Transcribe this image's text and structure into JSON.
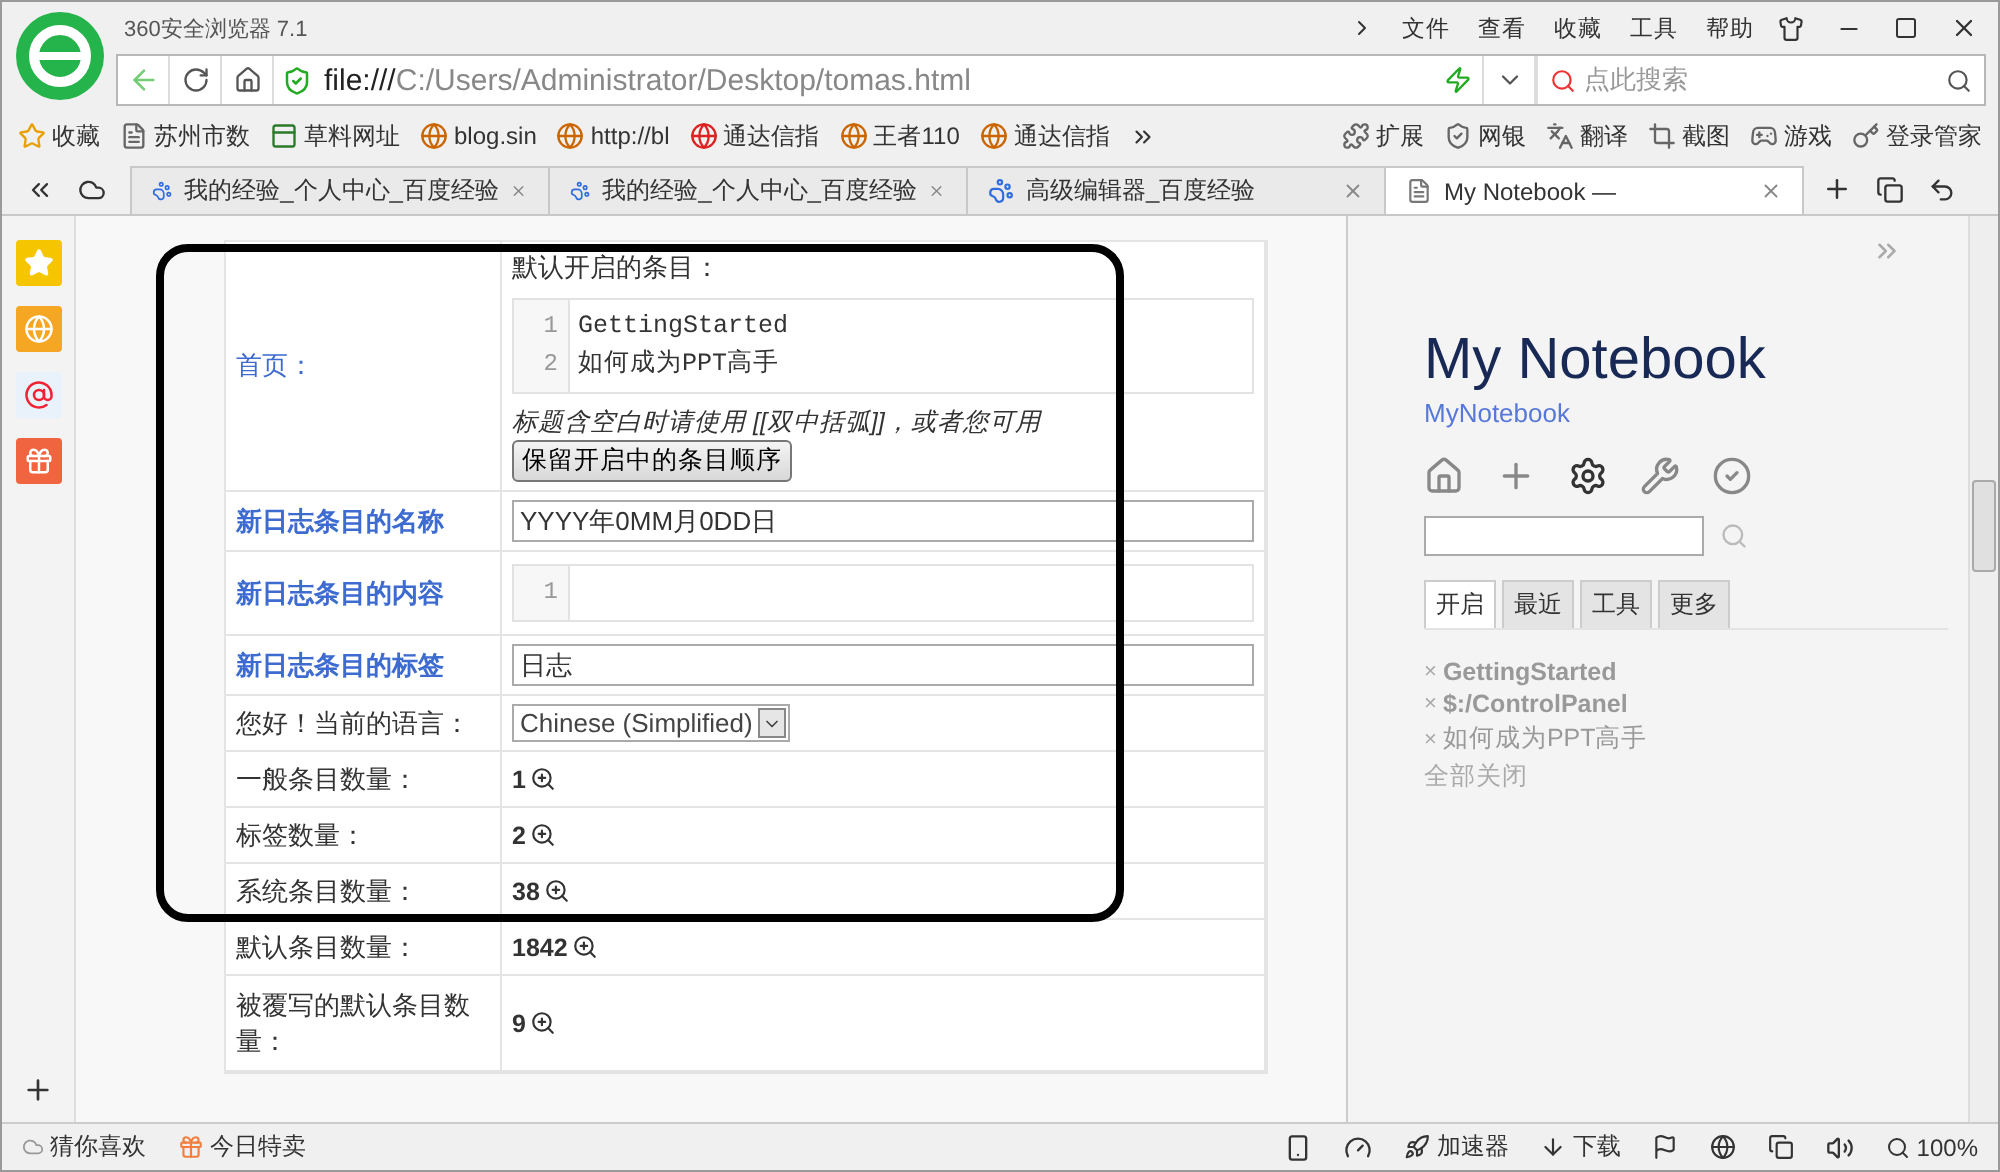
{
  "window": {
    "title": "360安全浏览器 7.1",
    "menu": [
      "文件",
      "查看",
      "收藏",
      "工具",
      "帮助"
    ]
  },
  "address": {
    "scheme": "file:///",
    "path": "C:/Users/Administrator/Desktop/tomas.html",
    "search_placeholder": "点此搜索"
  },
  "bookmarks": [
    {
      "label": "收藏",
      "kind": "star"
    },
    {
      "label": "苏州市数",
      "kind": "page"
    },
    {
      "label": "草料网址",
      "kind": "qr"
    },
    {
      "label": "blog.sin",
      "kind": "site"
    },
    {
      "label": "http://bl",
      "kind": "site"
    },
    {
      "label": "通达信指",
      "kind": "red"
    },
    {
      "label": "王者110",
      "kind": "site"
    },
    {
      "label": "通达信指",
      "kind": "site"
    }
  ],
  "tools": [
    "扩展",
    "网银",
    "翻译",
    "截图",
    "游戏",
    "登录管家"
  ],
  "tabs": [
    {
      "label": "我的经验_个人中心_百度经验",
      "selected": false
    },
    {
      "label": "我的经验_个人中心_百度经验",
      "selected": false
    },
    {
      "label": "高级编辑器_百度经验",
      "selected": false
    },
    {
      "label": "My Notebook —",
      "selected": true
    }
  ],
  "table": {
    "rows": [
      {
        "kind": "home",
        "label": "首页：",
        "link": true,
        "bold": false,
        "intro": "默认开启的条目：",
        "line_numbers": [
          "1",
          "2"
        ],
        "code_lines": [
          "GettingStarted",
          "如何成为PPT高手"
        ],
        "hint": "标题含空白时请使用 [[双中括弧]]，或者您可用",
        "button": "保留开启中的条目顺序"
      },
      {
        "kind": "text",
        "label": "新日志条目的名称",
        "link": true,
        "bold": true,
        "value": "YYYY年0MM月0DD日"
      },
      {
        "kind": "editor",
        "label": "新日志条目的内容",
        "link": true,
        "bold": true,
        "line_numbers": [
          "1"
        ]
      },
      {
        "kind": "text",
        "label": "新日志条目的标签",
        "link": true,
        "bold": true,
        "value": "日志"
      },
      {
        "kind": "select",
        "label": "您好！当前的语言：",
        "link": false,
        "bold": false,
        "value": "Chinese (Simplified)"
      },
      {
        "kind": "count",
        "label": "一般条目数量：",
        "link": false,
        "bold": false,
        "value": "1"
      },
      {
        "kind": "count",
        "label": "标签数量：",
        "link": false,
        "bold": false,
        "value": "2"
      },
      {
        "kind": "count",
        "label": "系统条目数量：",
        "link": false,
        "bold": false,
        "value": "38"
      },
      {
        "kind": "count",
        "label": "默认条目数量：",
        "link": false,
        "bold": false,
        "value": "1842"
      },
      {
        "kind": "count",
        "label": "被覆写的默认条目数量：",
        "link": false,
        "bold": false,
        "value": "9"
      }
    ]
  },
  "notebook": {
    "title": "My Notebook",
    "subtitle": "MyNotebook",
    "tabs": [
      {
        "label": "开启",
        "selected": true
      },
      {
        "label": "最近",
        "selected": false
      },
      {
        "label": "工具",
        "selected": false
      },
      {
        "label": "更多",
        "selected": false
      }
    ],
    "open_items": [
      {
        "close": "×",
        "title": "GettingStarted",
        "bold": true
      },
      {
        "close": "×",
        "title": "$:/ControlPanel",
        "bold": true
      },
      {
        "close": "×",
        "title": "如何成为PPT高手",
        "bold": false
      }
    ],
    "close_all": "全部关闭"
  },
  "status_bar": {
    "left": [
      "猜你喜欢",
      "今日特卖"
    ],
    "accelerator": "加速器",
    "download": "下载",
    "zoom": "100%"
  }
}
